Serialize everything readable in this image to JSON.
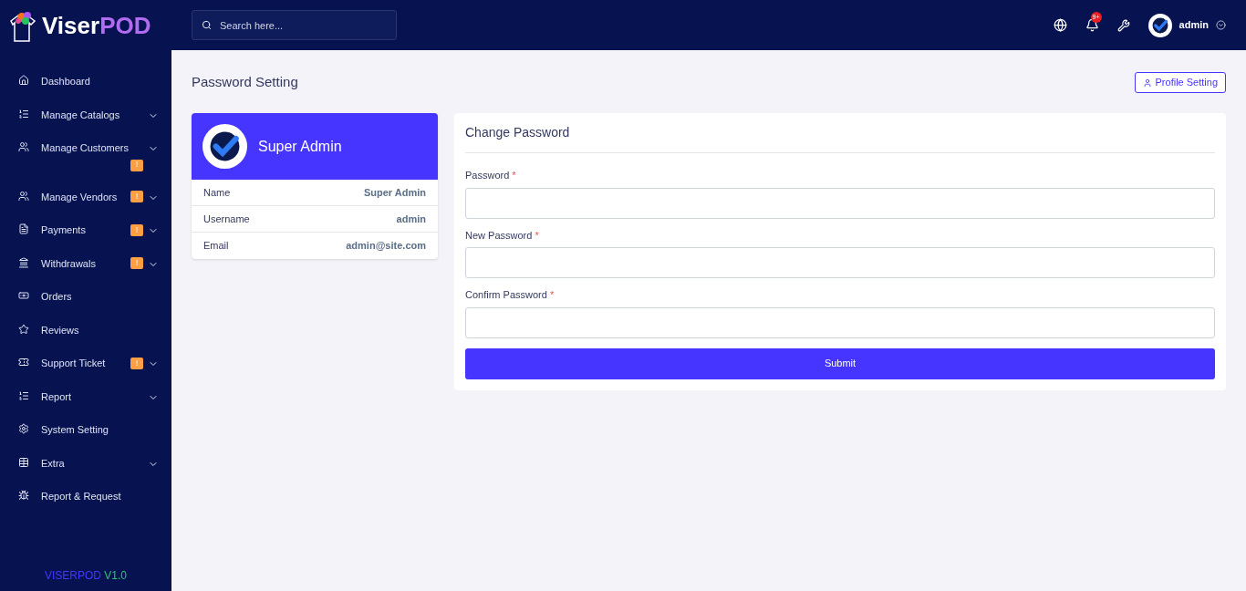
{
  "brand": {
    "logo_part1": "Viser",
    "logo_part2": "POD"
  },
  "sidebar": {
    "items": [
      {
        "label": "Dashboard",
        "has_submenu": false
      },
      {
        "label": "Manage Catalogs",
        "has_submenu": true
      },
      {
        "label": "Manage Customers",
        "has_submenu": true,
        "badge": "!"
      },
      {
        "label": "Manage Vendors",
        "has_submenu": true,
        "badge": "!"
      },
      {
        "label": "Payments",
        "has_submenu": true,
        "badge": "!"
      },
      {
        "label": "Withdrawals",
        "has_submenu": true,
        "badge": "!"
      },
      {
        "label": "Orders",
        "has_submenu": false
      },
      {
        "label": "Reviews",
        "has_submenu": false
      },
      {
        "label": "Support Ticket",
        "has_submenu": true,
        "badge": "!"
      },
      {
        "label": "Report",
        "has_submenu": true
      },
      {
        "label": "System Setting",
        "has_submenu": false
      },
      {
        "label": "Extra",
        "has_submenu": true
      },
      {
        "label": "Report & Request",
        "has_submenu": false
      }
    ],
    "version_name": "VISERPOD",
    "version_number": "V1.0"
  },
  "topbar": {
    "search": {
      "placeholder": "Search here..."
    },
    "notification_count": "9+",
    "user": "admin"
  },
  "page": {
    "title": "Password Setting",
    "profile_button": "Profile Setting"
  },
  "profile_card": {
    "name": "Super Admin",
    "rows": [
      {
        "label": "Name",
        "value": "Super Admin"
      },
      {
        "label": "Username",
        "value": "admin"
      },
      {
        "label": "Email",
        "value": "admin@site.com"
      }
    ]
  },
  "form": {
    "title": "Change Password",
    "fields": [
      {
        "label": "Password",
        "required": "*"
      },
      {
        "label": "New Password",
        "required": "*"
      },
      {
        "label": "Confirm Password",
        "required": "*"
      }
    ],
    "submit": "Submit"
  }
}
